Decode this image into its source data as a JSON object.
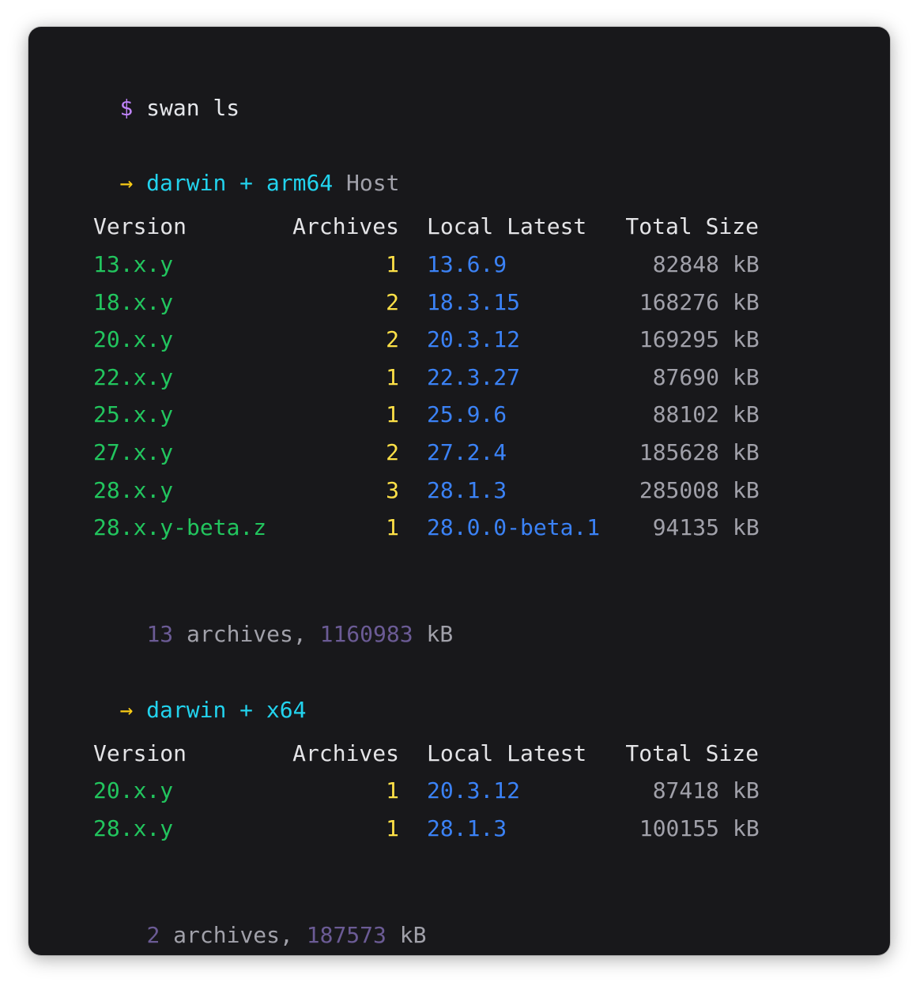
{
  "command": {
    "prompt": "$",
    "text": "swan ls"
  },
  "groups": [
    {
      "arrow": "→",
      "os": "darwin",
      "plus": "+",
      "arch": "arm64",
      "tag": "Host",
      "headers": {
        "version": "Version",
        "archives": "Archives",
        "latest": "Local Latest",
        "size": "Total Size"
      },
      "rows": [
        {
          "version": "13.x.y",
          "archives": "1",
          "latest": "13.6.9",
          "size": "82848",
          "unit": "kB"
        },
        {
          "version": "18.x.y",
          "archives": "2",
          "latest": "18.3.15",
          "size": "168276",
          "unit": "kB"
        },
        {
          "version": "20.x.y",
          "archives": "2",
          "latest": "20.3.12",
          "size": "169295",
          "unit": "kB"
        },
        {
          "version": "22.x.y",
          "archives": "1",
          "latest": "22.3.27",
          "size": "87690",
          "unit": "kB"
        },
        {
          "version": "25.x.y",
          "archives": "1",
          "latest": "25.9.6",
          "size": "88102",
          "unit": "kB"
        },
        {
          "version": "27.x.y",
          "archives": "2",
          "latest": "27.2.4",
          "size": "185628",
          "unit": "kB"
        },
        {
          "version": "28.x.y",
          "archives": "3",
          "latest": "28.1.3",
          "size": "285008",
          "unit": "kB"
        },
        {
          "version": "28.x.y-beta.z",
          "archives": "1",
          "latest": "28.0.0-beta.1",
          "size": "94135",
          "unit": "kB"
        }
      ],
      "summary": {
        "count": "13",
        "count_label": "archives,",
        "total": "1160983",
        "unit": "kB"
      }
    },
    {
      "arrow": "→",
      "os": "darwin",
      "plus": "+",
      "arch": "x64",
      "tag": "",
      "headers": {
        "version": "Version",
        "archives": "Archives",
        "latest": "Local Latest",
        "size": "Total Size"
      },
      "rows": [
        {
          "version": "20.x.y",
          "archives": "1",
          "latest": "20.3.12",
          "size": "87418",
          "unit": "kB"
        },
        {
          "version": "28.x.y",
          "archives": "1",
          "latest": "28.1.3",
          "size": "100155",
          "unit": "kB"
        }
      ],
      "summary": {
        "count": "2",
        "count_label": "archives,",
        "total": "187573",
        "unit": "kB"
      }
    }
  ],
  "colors": {
    "background": "#18181b",
    "prompt": "#c084fc",
    "arrow": "#facc15",
    "platform": "#22d3ee",
    "version": "#22c55e",
    "archives": "#fde047",
    "latest": "#3b82f6",
    "size": "#a1a1aa",
    "summary_number": "#6b5b95"
  }
}
